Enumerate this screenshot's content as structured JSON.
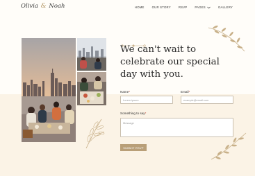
{
  "header": {
    "logo": {
      "first": "Olivia",
      "amp": "&",
      "second": "Noah"
    },
    "nav": [
      {
        "label": "HOME"
      },
      {
        "label": "OUR STORY"
      },
      {
        "label": "RSVP"
      },
      {
        "label": "PAGES"
      },
      {
        "label": "GALLERY"
      }
    ]
  },
  "main": {
    "heading": "We can't wait to celebrate our special day with you."
  },
  "form": {
    "name": {
      "label": "Name",
      "required_mark": "*",
      "placeholder": "Lorem ipsum"
    },
    "email": {
      "label": "Email",
      "required_mark": "*",
      "placeholder": "example@email.com"
    },
    "message": {
      "label": "Something to say",
      "required_mark": "*",
      "placeholder": "Message"
    },
    "submit_label": "SUBMIT RSVP"
  },
  "colors": {
    "accent": "#b99f78",
    "band": "#fbf3e6",
    "background": "#fffdf9"
  }
}
